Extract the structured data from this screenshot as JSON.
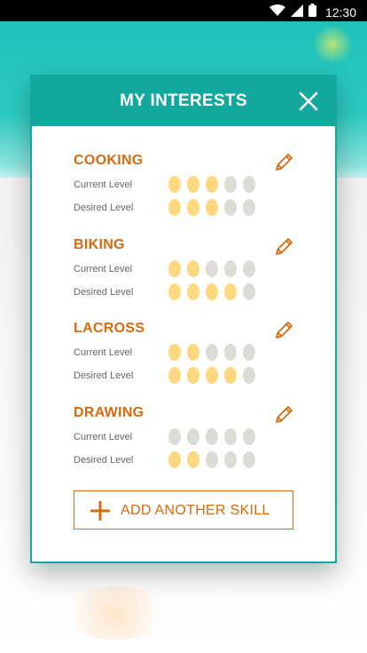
{
  "status_bar": {
    "time": "12:30",
    "icons": [
      "wifi-icon",
      "signal-icon",
      "battery-icon"
    ]
  },
  "modal": {
    "title": "MY INTERESTS",
    "close_icon": "close-icon",
    "edit_icon": "pencil-icon",
    "current_label": "Current Level",
    "desired_label": "Desired Level",
    "max_level": 5,
    "skills": [
      {
        "name": "COOKING",
        "current": 3,
        "desired": 3
      },
      {
        "name": "BIKING",
        "current": 2,
        "desired": 4
      },
      {
        "name": "LACROSS",
        "current": 2,
        "desired": 4
      },
      {
        "name": "DRAWING",
        "current": 0,
        "desired": 2
      }
    ],
    "add_button": {
      "label": "ADD ANOTHER SKILL",
      "icon": "plus-icon"
    }
  },
  "colors": {
    "teal": "#13a89e",
    "orange": "#d7690e",
    "dot_on": "#fdd87f",
    "dot_off": "#dddbd6"
  }
}
